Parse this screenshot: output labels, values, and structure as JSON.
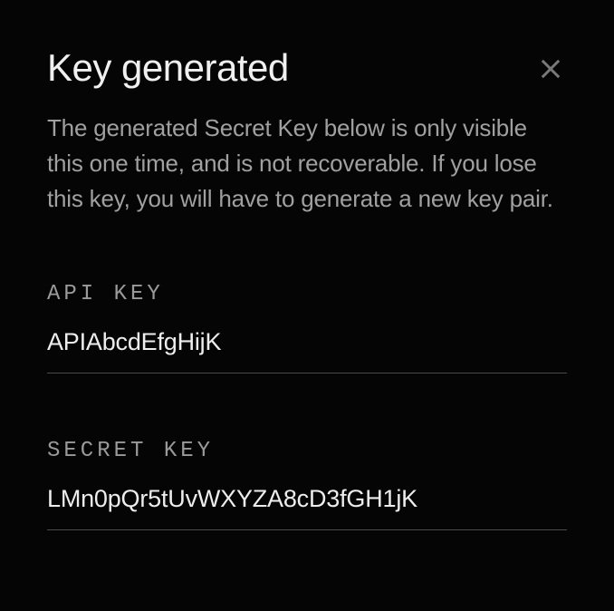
{
  "dialog": {
    "title": "Key generated",
    "description": "The generated Secret Key below is only visible this one time, and is not recoverable. If you lose this key, you will have to generate a new key pair."
  },
  "fields": {
    "apiKey": {
      "label": "API KEY",
      "value": "APIAbcdEfgHijK"
    },
    "secretKey": {
      "label": "SECRET KEY",
      "value": "LMn0pQr5tUvWXYZA8cD3fGH1jK"
    }
  }
}
